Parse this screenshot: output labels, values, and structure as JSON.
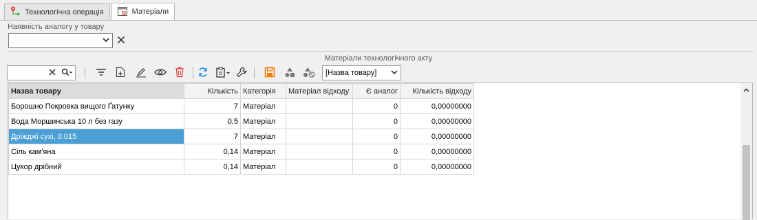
{
  "tabs": [
    {
      "label": "Технологічна операція",
      "icon": "route-icon"
    },
    {
      "label": "Матеріали",
      "icon": "calendar-icon"
    }
  ],
  "filter": {
    "label": "Наявність аналогу у товару",
    "value": ""
  },
  "section_title": "Матеріали технологічного акту",
  "toolbar": {
    "search_value": "",
    "column_select": "[Назва товару]"
  },
  "columns": [
    "Назва товару",
    "Кількість",
    "Категорія",
    "Матеріал відходу",
    "Є аналог",
    "Кількість відходу"
  ],
  "rows": [
    {
      "name": "Борошно Покровка вищого Ґатунку",
      "qty": "7",
      "category": "Матеріал",
      "waste_material": "",
      "has_analog": "0",
      "waste_qty": "0,00000000"
    },
    {
      "name": "Вода Моршинська 10 л без газу",
      "qty": "0,5",
      "category": "Матеріал",
      "waste_material": "",
      "has_analog": "0",
      "waste_qty": "0,00000000"
    },
    {
      "name": "Дріжджі сухі, 0.015",
      "qty": "7",
      "category": "Матеріал",
      "waste_material": "",
      "has_analog": "0",
      "waste_qty": "0,00000000"
    },
    {
      "name": "Сіль кам'яна",
      "qty": "0,14",
      "category": "Матеріал",
      "waste_material": "",
      "has_analog": "0",
      "waste_qty": "0,00000000"
    },
    {
      "name": "Цукор дрібний",
      "qty": "0,14",
      "category": "Матеріал",
      "waste_material": "",
      "has_analog": "0",
      "waste_qty": "0,00000000"
    }
  ],
  "selected_row": 2
}
